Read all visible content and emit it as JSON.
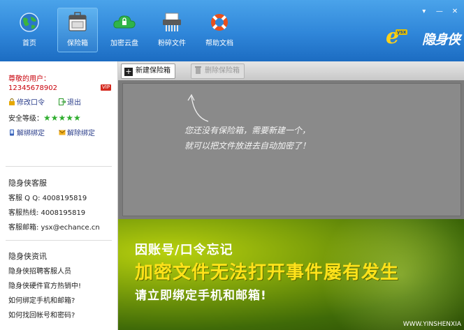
{
  "nav": {
    "items": [
      {
        "label": "首页",
        "icon": "globe-icon"
      },
      {
        "label": "保险箱",
        "icon": "safe-icon",
        "active": true
      },
      {
        "label": "加密云盘",
        "icon": "cloud-icon"
      },
      {
        "label": "粉碎文件",
        "icon": "shredder-icon"
      },
      {
        "label": "帮助文档",
        "icon": "lifebuoy-icon"
      }
    ]
  },
  "window": {
    "controls": [
      "▾",
      "—",
      "✕"
    ]
  },
  "logo": {
    "badge": "ysx",
    "text": "隐身侠"
  },
  "sidebar": {
    "greeting": "尊敬的用户：",
    "user_id": "12345678902",
    "vip": "VIP",
    "change_password": "修改口令",
    "logout": "退出",
    "security_label": "安全等级：",
    "security_stars": "★★★★★",
    "security_level": 5,
    "unbind_1": "解绑绑定",
    "unbind_2": "解除绑定",
    "service_title": "隐身侠客服",
    "service_qq": "客服 Q Q: 4008195819",
    "service_hotline": "客服热线: 4008195819",
    "service_email": "客服邮箱: ysx@echance.cn",
    "news_title": "隐身侠资讯",
    "news": [
      "隐身侠招聘客服人员",
      "隐身侠硬件官方热销中!",
      "如何绑定手机和邮箱?",
      "如何找回帐号和密码?"
    ]
  },
  "main": {
    "new_safe": "新建保险箱",
    "delete_safe": "删除保险箱",
    "hint_line1": "您还没有保险箱，需要新建一个，",
    "hint_line2": "就可以把文件放进去自动加密了！"
  },
  "banner": {
    "line1": "因账号/口令忘记",
    "line2": "加密文件无法打开事件屡有发生",
    "line3": "请立即绑定手机和邮箱!",
    "url": "WWW.YINSHENXIA"
  },
  "colors": {
    "toolbar_blue": "#2f86d9",
    "accent_red": "#c8000a",
    "star_green": "#2fae2f",
    "banner_yellow": "#ffe21a"
  }
}
